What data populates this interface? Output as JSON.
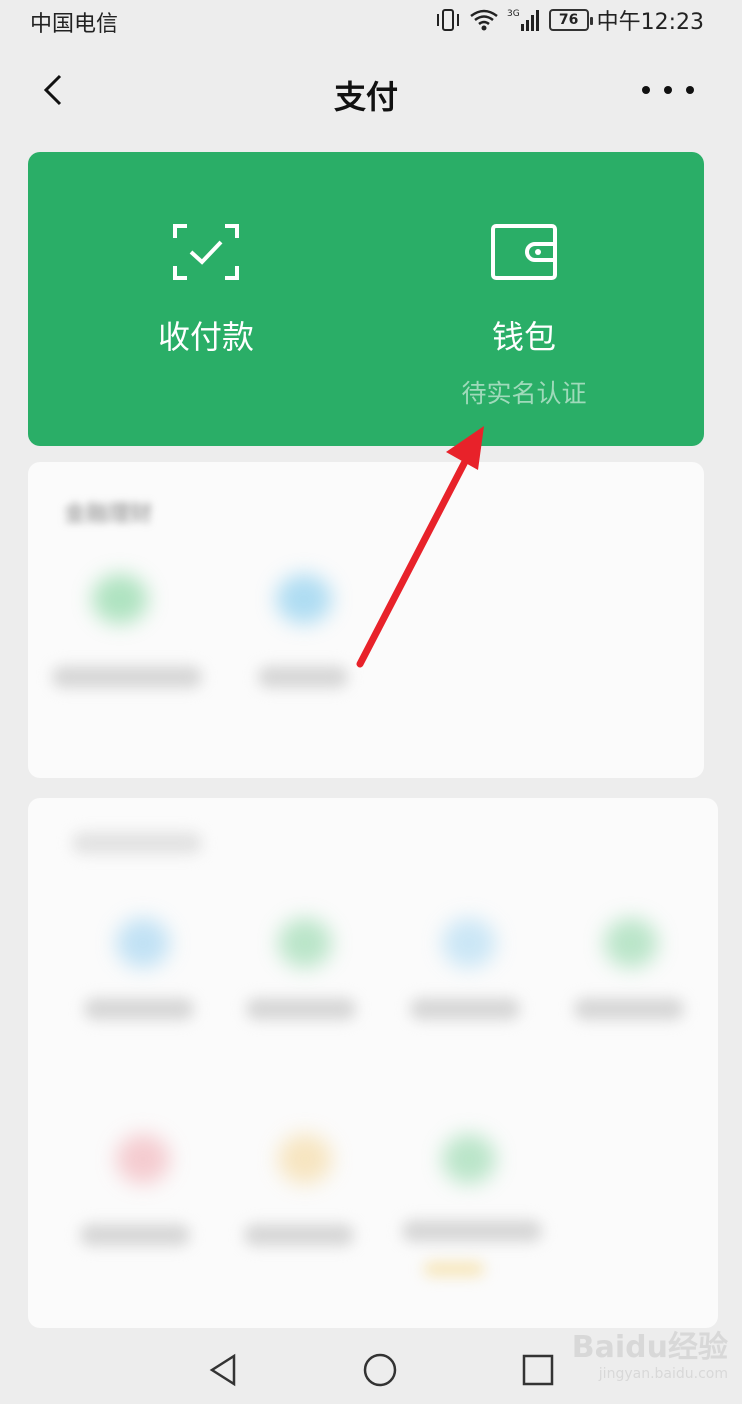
{
  "status_bar": {
    "carrier": "中国电信",
    "network": "3G",
    "battery": "76",
    "time": "中午12:23"
  },
  "nav": {
    "title": "支付"
  },
  "pay_card": {
    "background": "#2aae67",
    "left_label": "收付款",
    "right_label": "钱包",
    "right_sublabel": "待实名认证"
  },
  "blurred_section": {
    "title": "金融理财"
  },
  "annotation": {
    "arrow_color": "#e8222a"
  },
  "watermark": {
    "brand": "Baidu经验",
    "url": "jingyan.baidu.com"
  }
}
